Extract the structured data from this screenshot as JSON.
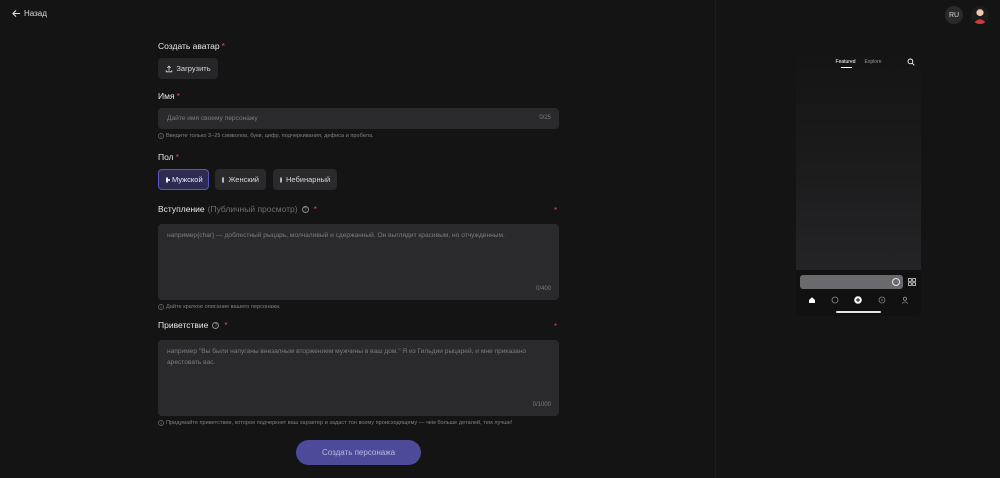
{
  "header": {
    "back_label": "Назад",
    "language": "RU"
  },
  "form": {
    "avatar": {
      "label": "Создать аватар",
      "required_mark": "*",
      "upload_label": "Загрузить"
    },
    "name": {
      "label": "Имя",
      "required_mark": "*",
      "placeholder": "Дайте имя своему персонажу",
      "counter": "0/25",
      "help": "Введите только 3–25 символов, букв, цифр, подчеркивания, дефиса и пробела."
    },
    "gender": {
      "label": "Пол",
      "required_mark": "*",
      "options": [
        {
          "label": "Мужской",
          "selected": true
        },
        {
          "label": "Женский",
          "selected": false
        },
        {
          "label": "Небинарный",
          "selected": false
        }
      ]
    },
    "intro": {
      "label": "Вступление",
      "sublabel": "(Публичный просмотр)",
      "required_mark": "*",
      "placeholder": "например{char} — доблестный рыцарь, молчаливый и сдержанный. Он выглядит красивым, но отчужденным.",
      "counter": "0/400",
      "help": "Дайте краткое описание вашего персонажа."
    },
    "greeting": {
      "label": "Приветствие",
      "required_mark": "*",
      "placeholder": "например \"Вы были напуганы внезапным вторжением мужчины в ваш дом.\" Я из Гильдии рыцарей, и мне приказано арестовать вас.",
      "counter": "0/1000",
      "help": "Придумайте приветствие, которое подчеркнет ваш характер и задаст тон всему происходящему — чем больше деталей, тем лучше!"
    },
    "submit_label": "Создать персонажа"
  },
  "preview": {
    "tabs": [
      "Featured",
      "Explore"
    ],
    "active_tab": "Featured",
    "nav_icons": [
      "home-icon",
      "chat-icon",
      "create-icon",
      "discover-icon",
      "profile-icon"
    ]
  },
  "colors": {
    "background": "#141415",
    "input_bg": "#2a2a2c",
    "accent": "#5a55c2",
    "submit_bg": "#4e4a9a",
    "required": "#e0464a"
  }
}
